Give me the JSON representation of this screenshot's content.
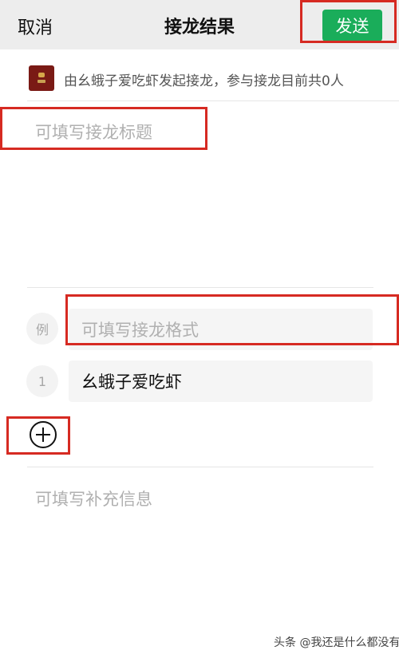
{
  "header": {
    "cancel_label": "取消",
    "title": "接龙结果",
    "send_label": "发送"
  },
  "initiator": {
    "text": "由幺蛾子爱吃虾发起接龙，参与接龙目前共0人"
  },
  "title_field": {
    "placeholder": "可填写接龙标题"
  },
  "format_row": {
    "index_label": "例",
    "placeholder": "可填写接龙格式"
  },
  "entries": [
    {
      "index": "1",
      "value": "幺蛾子爱吃虾"
    }
  ],
  "add_button": {
    "icon": "plus-circle-icon"
  },
  "extra_info": {
    "placeholder": "可填写补充信息"
  },
  "watermark": "头条 @我还是什么都没有",
  "colors": {
    "accent": "#1aad5a",
    "highlight": "#d62a22",
    "header_bg": "#ededed"
  }
}
